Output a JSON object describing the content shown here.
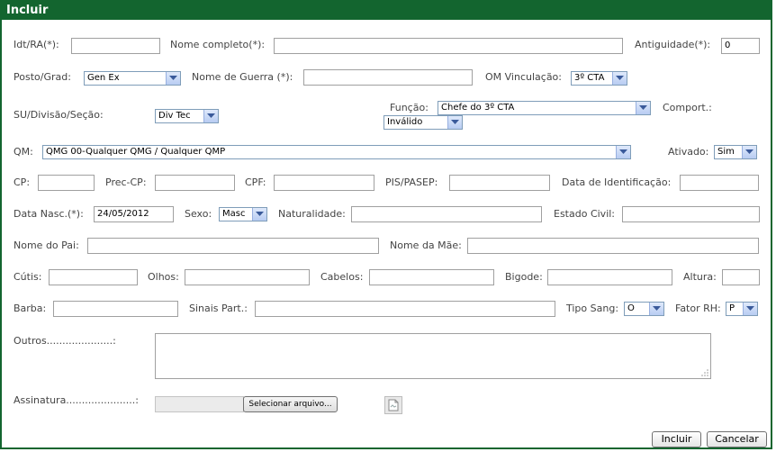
{
  "dialog": {
    "title": "Incluir"
  },
  "form": {
    "idt": {
      "label": "Idt/RA(*):",
      "value": ""
    },
    "nome_completo": {
      "label": "Nome completo(*):",
      "value": ""
    },
    "antiguidade": {
      "label": "Antiguidade(*):",
      "value": "0"
    },
    "posto": {
      "label": "Posto/Grad:",
      "selected": "Gen Ex"
    },
    "nome_guerra": {
      "label": "Nome de Guerra (*):",
      "value": ""
    },
    "om_vinculacao": {
      "label": "OM Vinculação:",
      "selected": "3º CTA"
    },
    "su_divisao": {
      "label": "SU/Divisão/Seção:",
      "selected": "Div Tec"
    },
    "funcao": {
      "label": "Função:",
      "selected": "Chefe do 3º CTA"
    },
    "comport": {
      "label": "Comport.:",
      "selected": "Inválido"
    },
    "qm": {
      "label": "QM:",
      "selected": "QMG 00-Qualquer QMG / Qualquer QMP"
    },
    "ativado": {
      "label": "Ativado:",
      "selected": "Sim"
    },
    "cp": {
      "label": "CP:",
      "value": ""
    },
    "prec_cp": {
      "label": "Prec-CP:",
      "value": ""
    },
    "cpf": {
      "label": "CPF:",
      "value": ""
    },
    "pis_pasep": {
      "label": "PIS/PASEP:",
      "value": ""
    },
    "data_identificacao": {
      "label": "Data de Identificação:",
      "value": ""
    },
    "data_nasc": {
      "label": "Data Nasc.(*):",
      "value": "24/05/2012"
    },
    "sexo": {
      "label": "Sexo:",
      "selected": "Masc"
    },
    "naturalidade": {
      "label": "Naturalidade:",
      "value": ""
    },
    "estado_civil": {
      "label": "Estado Civil:",
      "value": ""
    },
    "nome_pai": {
      "label": "Nome do Pai:",
      "value": ""
    },
    "nome_mae": {
      "label": "Nome da Mãe:",
      "value": ""
    },
    "cutis": {
      "label": "Cútis:",
      "value": ""
    },
    "olhos": {
      "label": "Olhos:",
      "value": ""
    },
    "cabelos": {
      "label": "Cabelos:",
      "value": ""
    },
    "bigode": {
      "label": "Bigode:",
      "value": ""
    },
    "altura": {
      "label": "Altura:",
      "value": ""
    },
    "barba": {
      "label": "Barba:",
      "value": ""
    },
    "sinais_part": {
      "label": "Sinais Part.:",
      "value": ""
    },
    "tipo_sang": {
      "label": "Tipo Sang:",
      "selected": "O"
    },
    "fator_rh": {
      "label": "Fator RH:",
      "selected": "P"
    },
    "outros": {
      "label": "Outros.....................:",
      "value": ""
    },
    "assinatura": {
      "label": "Assinatura......................:",
      "button_label": "Selecionar arquivo...",
      "icon": "document-icon"
    }
  },
  "footer": {
    "incluir_label": "Incluir",
    "cancelar_label": "Cancelar"
  }
}
